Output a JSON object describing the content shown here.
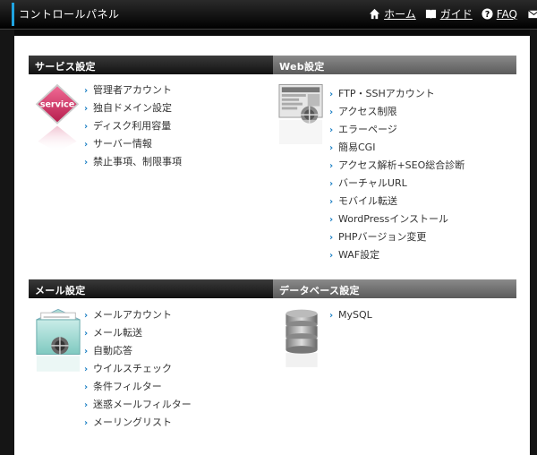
{
  "header": {
    "title": "コントロールパネル",
    "nav": [
      {
        "label": "ホーム",
        "icon": "home-icon"
      },
      {
        "label": "ガイド",
        "icon": "book-icon"
      },
      {
        "label": "FAQ",
        "icon": "question-icon"
      }
    ],
    "mail_icon": "mail-icon"
  },
  "sections": {
    "service": {
      "title": "サービス設定",
      "badge_text": "service",
      "items": [
        "管理者アカウント",
        "独自ドメイン設定",
        "ディスク利用容量",
        "サーバー情報",
        "禁止事項、制限事項"
      ]
    },
    "web": {
      "title": "Web設定",
      "items": [
        "FTP・SSHアカウント",
        "アクセス制限",
        "エラーページ",
        "簡易CGI",
        "アクセス解析+SEO総合診断",
        "バーチャルURL",
        "モバイル転送",
        "WordPressインストール",
        "PHPバージョン変更",
        "WAF設定"
      ]
    },
    "mail": {
      "title": "メール設定",
      "items": [
        "メールアカウント",
        "メール転送",
        "自動応答",
        "ウイルスチェック",
        "条件フィルター",
        "迷惑メールフィルター",
        "メーリングリスト"
      ]
    },
    "database": {
      "title": "データベース設定",
      "items": [
        "MySQL"
      ]
    }
  },
  "colors": {
    "accent": "#1fa3e0",
    "link_chevron": "#1a7fc4",
    "service_badge": "#d8346a"
  }
}
